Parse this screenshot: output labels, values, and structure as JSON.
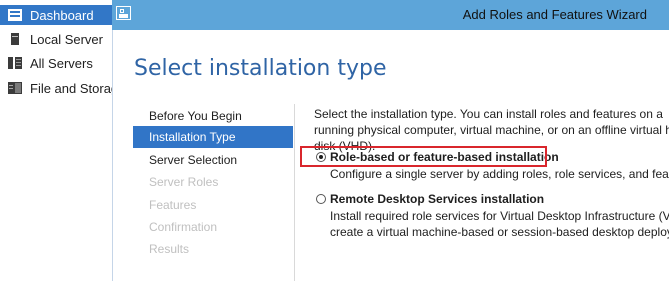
{
  "server_manager": {
    "items": [
      {
        "label": "Dashboard",
        "icon": "dashboard-icon"
      },
      {
        "label": "Local Server",
        "icon": "local-server-icon"
      },
      {
        "label": "All Servers",
        "icon": "all-servers-icon"
      },
      {
        "label": "File and Storage Services",
        "icon": "file-storage-icon"
      }
    ]
  },
  "wizard": {
    "title": "Add Roles and Features Wizard",
    "page_title": "Select installation type",
    "nav": [
      {
        "label": "Before You Begin",
        "state": "normal"
      },
      {
        "label": "Installation Type",
        "state": "active"
      },
      {
        "label": "Server Selection",
        "state": "normal"
      },
      {
        "label": "Server Roles",
        "state": "disabled"
      },
      {
        "label": "Features",
        "state": "disabled"
      },
      {
        "label": "Confirmation",
        "state": "disabled"
      },
      {
        "label": "Results",
        "state": "disabled"
      }
    ],
    "intro": "Select the installation type. You can install roles and features on a running physical computer, virtual machine, or on an offline virtual hard disk (VHD).",
    "options": [
      {
        "label": "Role-based or feature-based installation",
        "description": "Configure a single server by adding roles, role services, and features.",
        "selected": true
      },
      {
        "label": "Remote Desktop Services installation",
        "description": "Install required role services for Virtual Desktop Infrastructure (VDI) to create a virtual machine-based or session-based desktop deployment.",
        "selected": false
      }
    ]
  },
  "colors": {
    "accent": "#3175c7",
    "title_bar": "#5da5d9",
    "page_title": "#2f64a5",
    "highlight_box": "#d9262c"
  }
}
